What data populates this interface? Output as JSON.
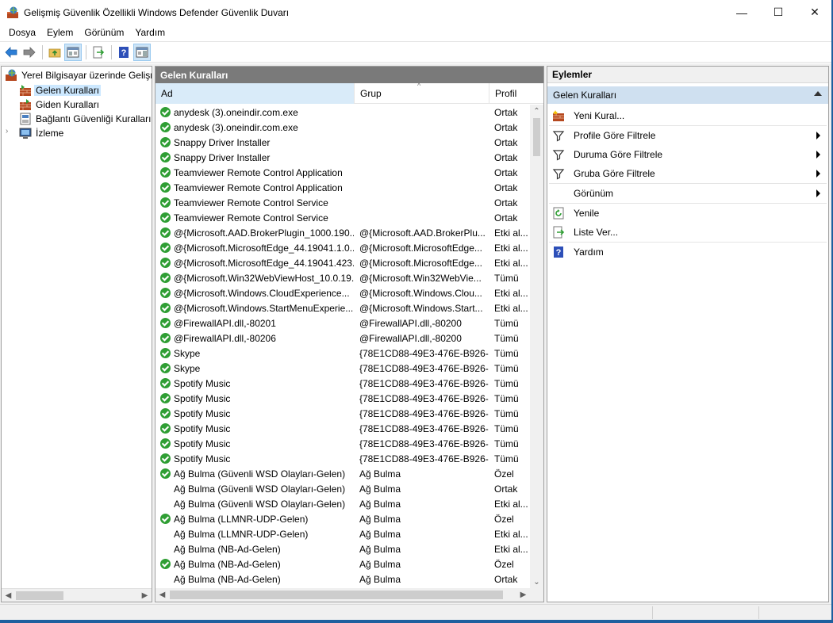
{
  "window": {
    "title": "Gelişmiş Güvenlik Özellikli Windows Defender Güvenlik Duvarı",
    "minimize": "—",
    "maximize": "☐",
    "close": "✕"
  },
  "menu": [
    "Dosya",
    "Eylem",
    "Görünüm",
    "Yardım"
  ],
  "tree": {
    "root": "Yerel Bilgisayar üzerinde Gelişm",
    "items": [
      "Gelen Kuralları",
      "Giden Kuralları",
      "Bağlantı Güvenliği Kuralları",
      "İzleme"
    ]
  },
  "center": {
    "title": "Gelen Kuralları",
    "columns": [
      "Ad",
      "Grup",
      "Profil"
    ],
    "rows": [
      {
        "name": "anydesk (3).oneindir.com.exe",
        "group": "",
        "profile": "Ortak",
        "enabled": true
      },
      {
        "name": "anydesk (3).oneindir.com.exe",
        "group": "",
        "profile": "Ortak",
        "enabled": true
      },
      {
        "name": "Snappy Driver Installer",
        "group": "",
        "profile": "Ortak",
        "enabled": true
      },
      {
        "name": "Snappy Driver Installer",
        "group": "",
        "profile": "Ortak",
        "enabled": true
      },
      {
        "name": "Teamviewer Remote Control Application",
        "group": "",
        "profile": "Ortak",
        "enabled": true
      },
      {
        "name": "Teamviewer Remote Control Application",
        "group": "",
        "profile": "Ortak",
        "enabled": true
      },
      {
        "name": "Teamviewer Remote Control Service",
        "group": "",
        "profile": "Ortak",
        "enabled": true
      },
      {
        "name": "Teamviewer Remote Control Service",
        "group": "",
        "profile": "Ortak",
        "enabled": true
      },
      {
        "name": "@{Microsoft.AAD.BrokerPlugin_1000.190...",
        "group": "@{Microsoft.AAD.BrokerPlu...",
        "profile": "Etki al...",
        "enabled": true
      },
      {
        "name": "@{Microsoft.MicrosoftEdge_44.19041.1.0...",
        "group": "@{Microsoft.MicrosoftEdge...",
        "profile": "Etki al...",
        "enabled": true
      },
      {
        "name": "@{Microsoft.MicrosoftEdge_44.19041.423...",
        "group": "@{Microsoft.MicrosoftEdge...",
        "profile": "Etki al...",
        "enabled": true
      },
      {
        "name": "@{Microsoft.Win32WebViewHost_10.0.19...",
        "group": "@{Microsoft.Win32WebVie...",
        "profile": "Tümü",
        "enabled": true
      },
      {
        "name": "@{Microsoft.Windows.CloudExperience...",
        "group": "@{Microsoft.Windows.Clou...",
        "profile": "Etki al...",
        "enabled": true
      },
      {
        "name": "@{Microsoft.Windows.StartMenuExperie...",
        "group": "@{Microsoft.Windows.Start...",
        "profile": "Etki al...",
        "enabled": true
      },
      {
        "name": "@FirewallAPI.dll,-80201",
        "group": "@FirewallAPI.dll,-80200",
        "profile": "Tümü",
        "enabled": true
      },
      {
        "name": "@FirewallAPI.dll,-80206",
        "group": "@FirewallAPI.dll,-80200",
        "profile": "Tümü",
        "enabled": true
      },
      {
        "name": "Skype",
        "group": "{78E1CD88-49E3-476E-B926-...",
        "profile": "Tümü",
        "enabled": true
      },
      {
        "name": "Skype",
        "group": "{78E1CD88-49E3-476E-B926-...",
        "profile": "Tümü",
        "enabled": true
      },
      {
        "name": "Spotify Music",
        "group": "{78E1CD88-49E3-476E-B926-...",
        "profile": "Tümü",
        "enabled": true
      },
      {
        "name": "Spotify Music",
        "group": "{78E1CD88-49E3-476E-B926-...",
        "profile": "Tümü",
        "enabled": true
      },
      {
        "name": "Spotify Music",
        "group": "{78E1CD88-49E3-476E-B926-...",
        "profile": "Tümü",
        "enabled": true
      },
      {
        "name": "Spotify Music",
        "group": "{78E1CD88-49E3-476E-B926-...",
        "profile": "Tümü",
        "enabled": true
      },
      {
        "name": "Spotify Music",
        "group": "{78E1CD88-49E3-476E-B926-...",
        "profile": "Tümü",
        "enabled": true
      },
      {
        "name": "Spotify Music",
        "group": "{78E1CD88-49E3-476E-B926-...",
        "profile": "Tümü",
        "enabled": true
      },
      {
        "name": "Ağ Bulma (Güvenli WSD Olayları-Gelen)",
        "group": "Ağ Bulma",
        "profile": "Özel",
        "enabled": true
      },
      {
        "name": "Ağ Bulma (Güvenli WSD Olayları-Gelen)",
        "group": "Ağ Bulma",
        "profile": "Ortak",
        "enabled": false
      },
      {
        "name": "Ağ Bulma (Güvenli WSD Olayları-Gelen)",
        "group": "Ağ Bulma",
        "profile": "Etki al...",
        "enabled": false
      },
      {
        "name": "Ağ Bulma (LLMNR-UDP-Gelen)",
        "group": "Ağ Bulma",
        "profile": "Özel",
        "enabled": true
      },
      {
        "name": "Ağ Bulma (LLMNR-UDP-Gelen)",
        "group": "Ağ Bulma",
        "profile": "Etki al...",
        "enabled": false
      },
      {
        "name": "Ağ Bulma (NB-Ad-Gelen)",
        "group": "Ağ Bulma",
        "profile": "Etki al...",
        "enabled": false
      },
      {
        "name": "Ağ Bulma (NB-Ad-Gelen)",
        "group": "Ağ Bulma",
        "profile": "Özel",
        "enabled": true
      },
      {
        "name": "Ağ Bulma (NB-Ad-Gelen)",
        "group": "Ağ Bulma",
        "profile": "Ortak",
        "enabled": false
      }
    ]
  },
  "actions": {
    "title": "Eylemler",
    "section": "Gelen Kuralları",
    "items": [
      {
        "label": "Yeni Kural...",
        "icon": "new-rule-icon"
      },
      {
        "label": "Profile Göre Filtrele",
        "icon": "filter-icon",
        "submenu": true
      },
      {
        "label": "Duruma Göre Filtrele",
        "icon": "filter-icon",
        "submenu": true
      },
      {
        "label": "Gruba Göre Filtrele",
        "icon": "filter-icon",
        "submenu": true
      },
      {
        "label": "Görünüm",
        "icon": "",
        "submenu": true
      },
      {
        "label": "Yenile",
        "icon": "refresh-icon"
      },
      {
        "label": "Liste Ver...",
        "icon": "export-icon"
      },
      {
        "label": "Yardım",
        "icon": "help-icon"
      }
    ]
  }
}
